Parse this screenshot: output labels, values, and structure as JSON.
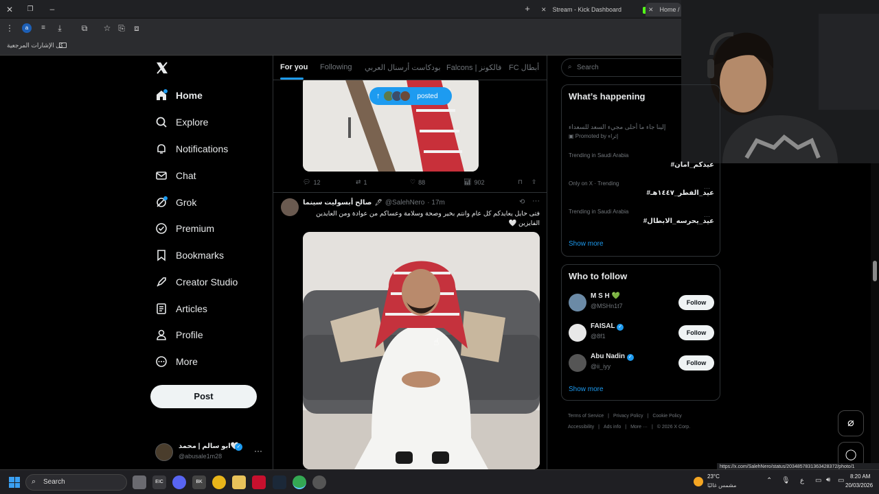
{
  "browser": {
    "tabs": [
      {
        "label": "Stream - Kick Dashboard"
      },
      {
        "label": "Home / X"
      }
    ],
    "new_tab_icon": "plus-icon",
    "bookmarks_label": "كل الإشارات المرجعية"
  },
  "nav": {
    "items": [
      {
        "label": "Home",
        "icon": "home-icon",
        "active": true
      },
      {
        "label": "Explore",
        "icon": "search-icon"
      },
      {
        "label": "Notifications",
        "icon": "bell-icon"
      },
      {
        "label": "Chat",
        "icon": "mail-icon"
      },
      {
        "label": "Grok",
        "icon": "grok-icon"
      },
      {
        "label": "Premium",
        "icon": "verified-icon"
      },
      {
        "label": "Bookmarks",
        "icon": "bookmark-icon"
      },
      {
        "label": "Creator Studio",
        "icon": "rocket-icon"
      },
      {
        "label": "Articles",
        "icon": "article-icon"
      },
      {
        "label": "Profile",
        "icon": "person-icon"
      },
      {
        "label": "More",
        "icon": "more-circle-icon"
      }
    ],
    "post_label": "Post",
    "account": {
      "name": "ابو سالم | محمد🤍",
      "handle": "@abusale1m28"
    }
  },
  "feed": {
    "tabs": [
      "For you",
      "Following",
      "بودكاست أرسنال العربي",
      "Falcons | فالكونز",
      "FC أبطال"
    ],
    "posted_pill": "posted",
    "post1_actions": {
      "replies": "12",
      "reposts": "1",
      "likes": "88",
      "views": "902"
    },
    "post2": {
      "author": "صالح أبسوليت سينما",
      "handle": "@SalehNero",
      "time": "· 17m",
      "text_line1": "فتى حايل يعايدكم كل عام وانتم بخير وصحة وسلامة وعساكم من عوادة ومن العايدين",
      "text_line2": "الفايزين 🤍"
    }
  },
  "right": {
    "search_placeholder": "Search",
    "happening_title": "What’s happening",
    "promo_text": "إلينا جاء ما أحلى مجيء السعد للسعداء",
    "promo_by": "Promoted by إثراء",
    "trends": [
      {
        "context": "Trending in Saudi Arabia",
        "tag": "#عيدكم_امان"
      },
      {
        "context": "Only on X · Trending",
        "tag": "#عيد_الفطر_١٤٤٧هـ"
      },
      {
        "context": "Trending in Saudi Arabia",
        "tag": "#عيد_يحرسه_الابطال"
      }
    ],
    "show_more": "Show more",
    "who_title": "Who to follow",
    "follow_label": "Follow",
    "suggestions": [
      {
        "name": "M S H 💚",
        "handle": "@MSHn1t7"
      },
      {
        "name": "FAISAL",
        "handle": "@8f1"
      },
      {
        "name": "Abu Nadin",
        "handle": "@ii_iyy"
      }
    ],
    "footer_line1": [
      "Terms of Service",
      "Privacy Policy",
      "Cookie Policy"
    ],
    "footer_line2": [
      "Accessibility",
      "Ads info",
      "More ···",
      "© 2026 X Corp."
    ]
  },
  "status_url": "https://x.com/SalehNero/status/2034857831363428372/photo/1",
  "taskbar": {
    "search_placeholder": "Search",
    "weather_temp": "23°C",
    "weather_desc": "مشمس غالبًا",
    "lang": "ع",
    "time": "8:20 AM",
    "date": "20/03/2026"
  }
}
